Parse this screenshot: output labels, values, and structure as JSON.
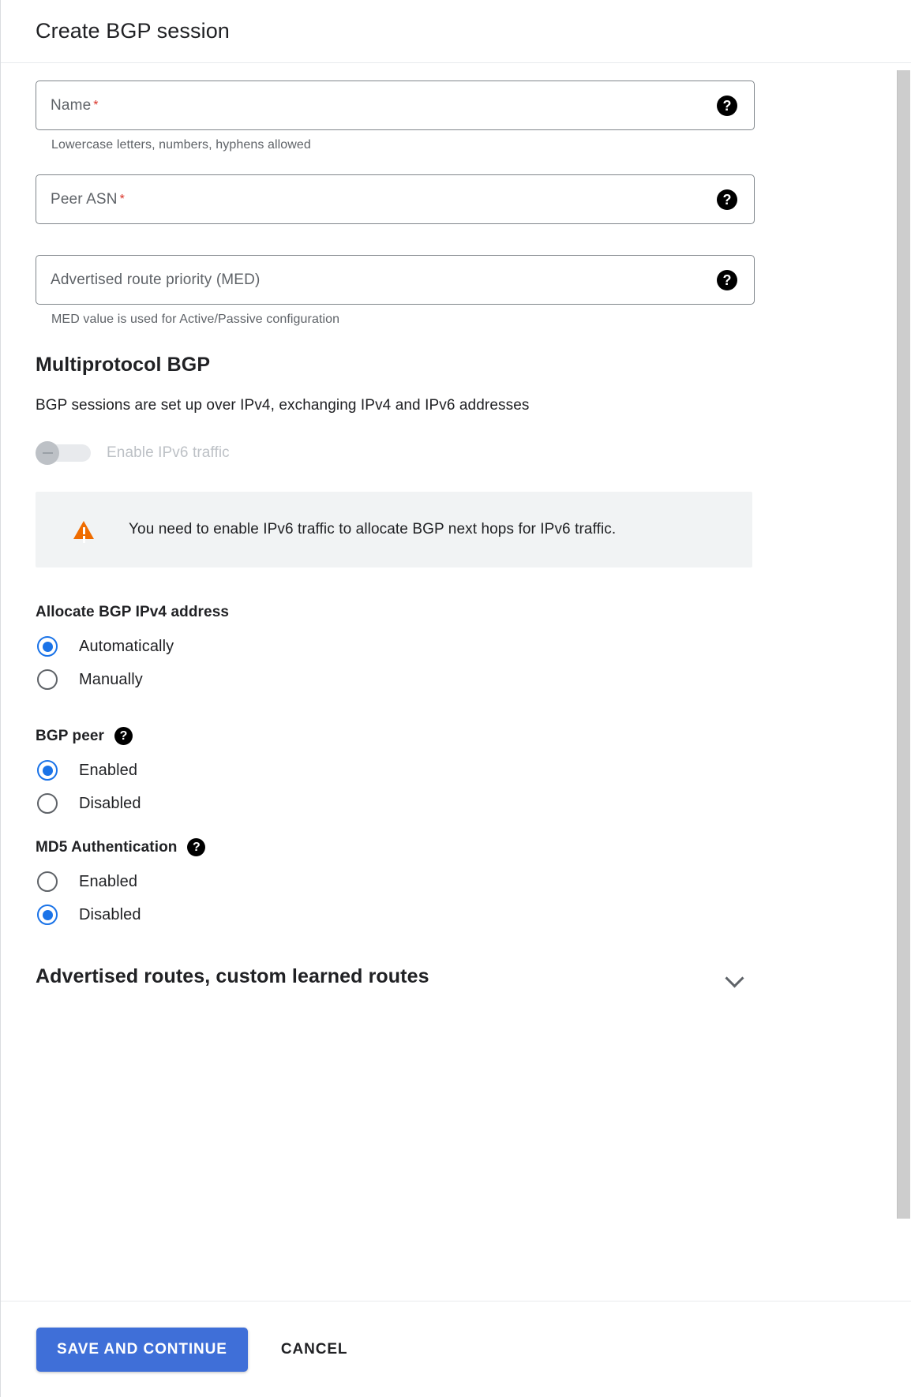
{
  "header": {
    "title": "Create BGP session"
  },
  "form": {
    "fields": [
      {
        "label": "Name",
        "required_marker": "*",
        "value": "",
        "hint": "Lowercase letters, numbers, hyphens allowed",
        "help_icon": "help-circle-icon"
      },
      {
        "label": "Peer ASN",
        "required_marker": "*",
        "value": "",
        "hint": "",
        "help_icon": "help-circle-icon"
      },
      {
        "label": "Advertised route priority (MED)",
        "required_marker": "",
        "value": "",
        "hint": "MED value is used for Active/Passive configuration",
        "help_icon": "help-circle-icon"
      }
    ]
  },
  "multiprotocol": {
    "title": "Multiprotocol BGP",
    "description": "BGP sessions are set up over IPv4, exchanging IPv4 and IPv6 addresses",
    "toggle": {
      "label": "Enable IPv6 traffic",
      "state": "off",
      "disabled": true,
      "icon": "toggle-dash-icon"
    },
    "warning": {
      "icon": "warning-triangle-icon",
      "color": "#ef6c00",
      "text": "You need to enable IPv6 traffic to allocate BGP next hops for IPv6 traffic."
    }
  },
  "allocate_ipv4": {
    "title": "Allocate BGP IPv4 address",
    "options": [
      {
        "label": "Automatically",
        "selected": true
      },
      {
        "label": "Manually",
        "selected": false
      }
    ]
  },
  "bgp_peer": {
    "title": "BGP peer",
    "help_icon": "help-circle-icon",
    "options": [
      {
        "label": "Enabled",
        "selected": true
      },
      {
        "label": "Disabled",
        "selected": false
      }
    ]
  },
  "md5_auth": {
    "title": "MD5 Authentication",
    "help_icon": "help-circle-icon",
    "options": [
      {
        "label": "Enabled",
        "selected": false
      },
      {
        "label": "Disabled",
        "selected": true
      }
    ]
  },
  "advertised_routes": {
    "title": "Advertised routes, custom learned routes",
    "expanded": false,
    "chevron_icon": "chevron-down-icon"
  },
  "footer": {
    "primary_label": "SAVE AND CONTINUE",
    "cancel_label": "CANCEL"
  },
  "colors": {
    "accent": "#1a73e8",
    "primary_button": "#3f6fd8",
    "required": "#d93025",
    "warning": "#ef6c00",
    "muted": "#5f6368",
    "banner_bg": "#f1f3f4"
  },
  "glyphs": {
    "help": "?"
  }
}
